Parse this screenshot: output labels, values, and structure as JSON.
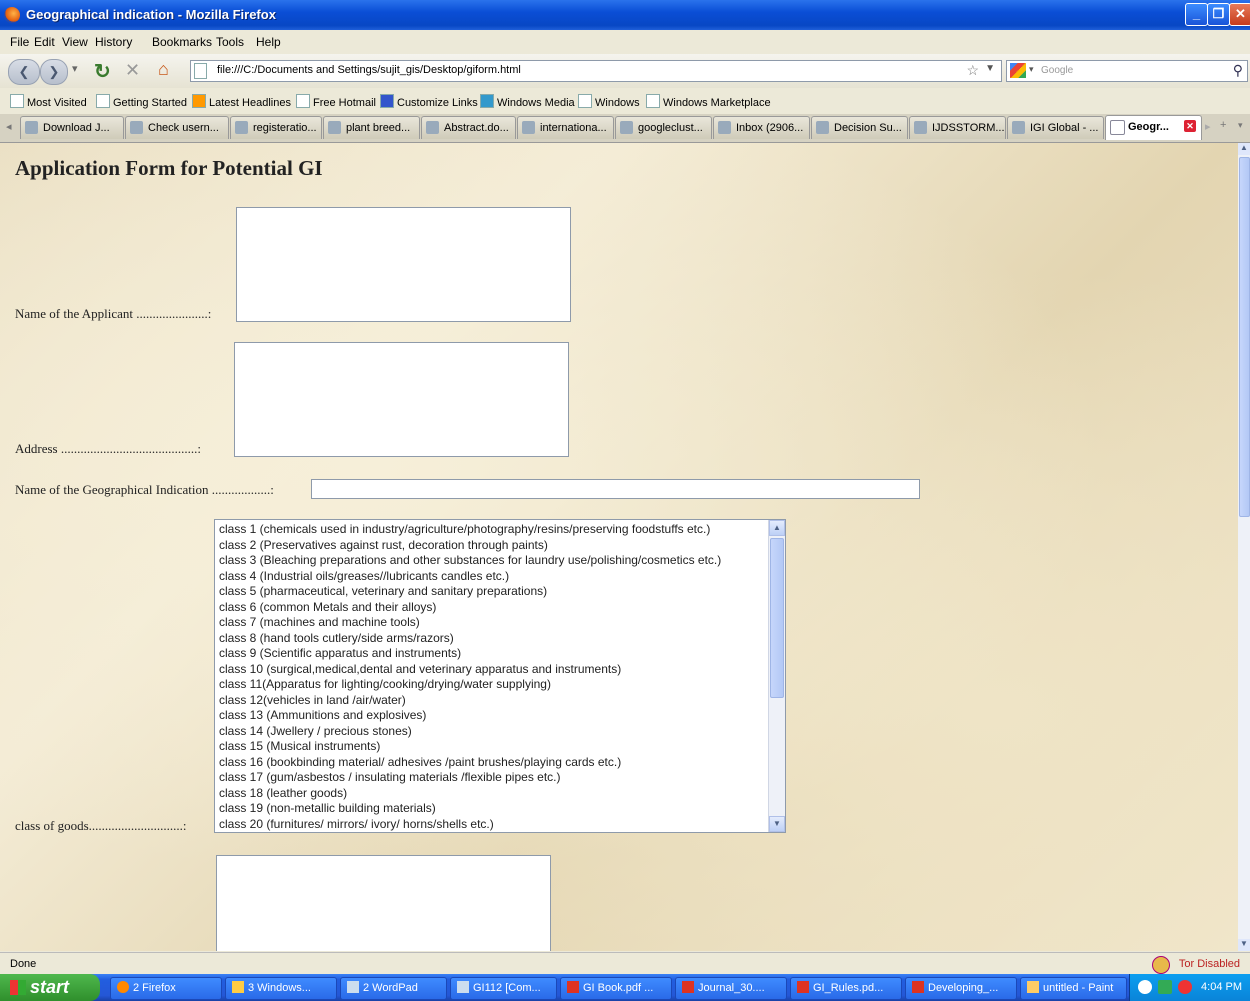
{
  "window": {
    "title": "Geographical indication - Mozilla Firefox"
  },
  "menu": [
    "File",
    "Edit",
    "View",
    "History",
    "Bookmarks",
    "Tools",
    "Help"
  ],
  "nav": {
    "url": "file:///C:/Documents and Settings/sujit_gis/Desktop/giform.html",
    "search_placeholder": "Google"
  },
  "bookmarks": [
    "Most Visited",
    "Getting Started",
    "Latest Headlines",
    "Free Hotmail",
    "Customize Links",
    "Windows Media",
    "Windows",
    "Windows Marketplace"
  ],
  "tabs": [
    "Download J...",
    "Check usern...",
    "registeratio...",
    "plant breed...",
    "Abstract.do...",
    "internationa...",
    "googleclust...",
    "Inbox (2906...",
    "Decision Su...",
    "IJDSSTORM...",
    "IGI Global - ...",
    "Geogr..."
  ],
  "form": {
    "heading": "Application Form for Potential GI",
    "applicant_label": "Name of the Applicant ......................:",
    "address_label": "Address ..........................................:",
    "gi_name_label": "Name of the Geographical Indication ..................:",
    "class_label": "class of goods.............................:",
    "classes": [
      "class 1 (chemicals used in industry/agriculture/photography/resins/preserving foodstuffs etc.)",
      "class 2 (Preservatives against rust, decoration through paints)",
      "class 3 (Bleaching preparations and other substances for laundry use/polishing/cosmetics etc.)",
      "class 4 (Industrial oils/greases//lubricants candles etc.)",
      "class 5 (pharmaceutical, veterinary and sanitary preparations)",
      "class 6 (common Metals and their alloys)",
      "class 7 (machines and machine tools)",
      "class 8 (hand tools cutlery/side arms/razors)",
      "class 9 (Scientific apparatus and instruments)",
      "class 10 (surgical,medical,dental and veterinary apparatus and instruments)",
      "class 11(Apparatus for lighting/cooking/drying/water supplying)",
      "class 12(vehicles in land /air/water)",
      "class 13 (Ammunitions and explosives)",
      "class 14 (Jwellery / precious stones)",
      "class 15 (Musical instruments)",
      "class 16 (bookbinding material/ adhesives /paint brushes/playing cards etc.)",
      "class 17 (gum/asbestos / insulating materials /flexible pipes etc.)",
      "class 18 (leather goods)",
      "class 19 (non-metallic building materials)",
      "class 20 (furnitures/ mirrors/ ivory/ horns/shells etc.)"
    ]
  },
  "status": {
    "text": "Done",
    "tor": "Tor Disabled"
  },
  "taskbar": {
    "start": "start",
    "items": [
      "2 Firefox",
      "3 Windows...",
      "2 WordPad",
      "GI112 [Com...",
      "GI Book.pdf ...",
      "Journal_30....",
      "GI_Rules.pd...",
      "Developing_...",
      "untitled - Paint"
    ],
    "time": "4:04 PM"
  }
}
